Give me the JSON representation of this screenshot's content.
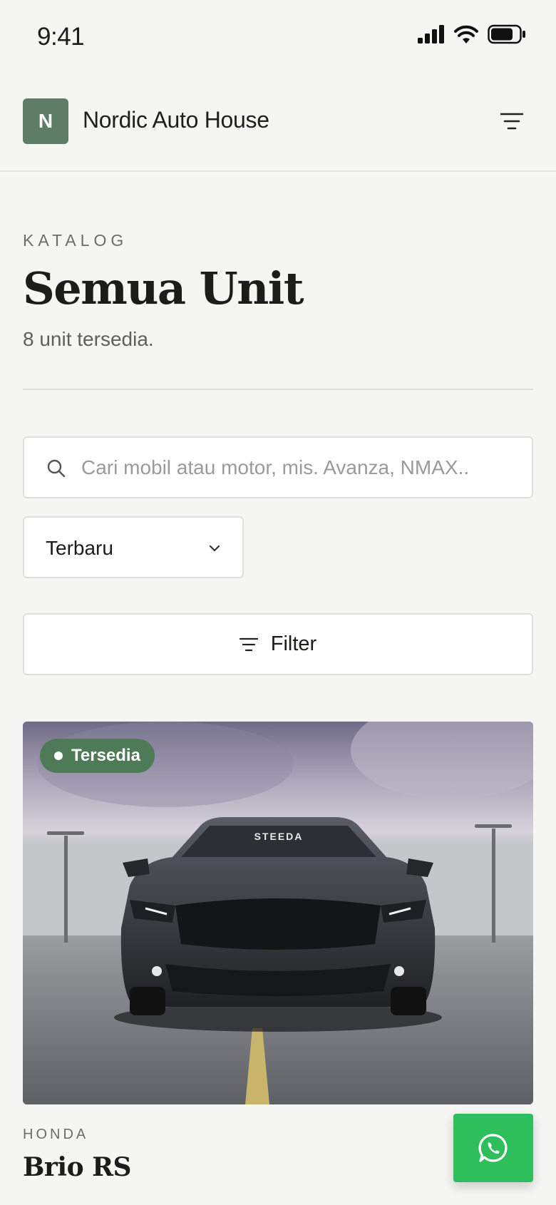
{
  "status_bar": {
    "time": "9:41"
  },
  "header": {
    "logo_letter": "N",
    "brand_name": "Nordic Auto House"
  },
  "catalog": {
    "eyebrow": "KATALOG",
    "title": "Semua Unit",
    "count_text": "8 unit tersedia."
  },
  "search": {
    "placeholder": "Cari mobil atau motor, mis. Avanza, NMAX..",
    "value": ""
  },
  "sort": {
    "selected": "Terbaru"
  },
  "filter": {
    "label": "Filter"
  },
  "listing": {
    "status_badge": "Tersedia",
    "brand": "HONDA",
    "model": "Brio RS",
    "image_windshield_text": "STEEDA"
  },
  "colors": {
    "accent": "#5d7d66",
    "badge": "#4e7a58",
    "whatsapp": "#2fbe5c",
    "background": "#f5f5f3"
  },
  "icons": [
    "signal-icon",
    "wifi-icon",
    "battery-icon",
    "menu-icon",
    "search-icon",
    "chevron-down-icon",
    "filter-icon",
    "whatsapp-icon"
  ]
}
